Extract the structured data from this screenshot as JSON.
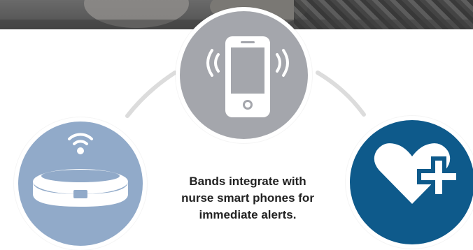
{
  "caption": {
    "line1": "Bands integrate with",
    "line2": "nurse smart phones for",
    "line3": "immediate alerts."
  },
  "nodes": [
    {
      "name": "phone",
      "icon": "smartphone-vibrating-icon",
      "color": "#a4a6ac"
    },
    {
      "name": "band",
      "icon": "wireless-band-icon",
      "color": "#91aac9"
    },
    {
      "name": "health",
      "icon": "heart-plus-icon",
      "color": "#0e5a8b"
    }
  ],
  "colors": {
    "connector": "#dcdcdc",
    "background": "#ffffff",
    "icon": "#ffffff"
  }
}
